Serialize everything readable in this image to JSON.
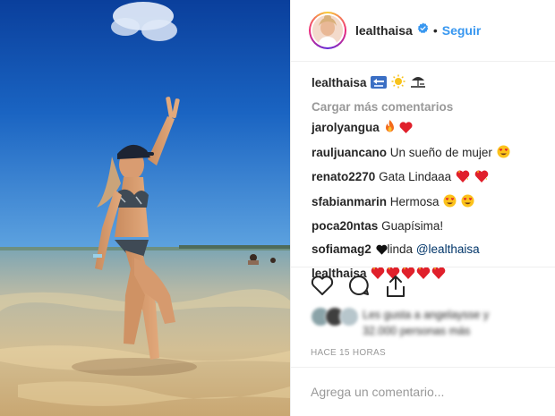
{
  "post": {
    "username": "lealthaisa",
    "separator": "•",
    "follow_label": "Seguir",
    "verified_icon": "verified-badge-icon",
    "accent_color": "#3897f0",
    "caption": {
      "username": "lealthaisa",
      "emojis": [
        "back-arrow-sign-icon",
        "sun-icon",
        "beach-umbrella-icon"
      ]
    },
    "load_more_label": "Cargar más comentarios",
    "comments": [
      {
        "username": "jarolyangua",
        "text": "",
        "emojis": [
          "fire-icon",
          "red-heart-icon"
        ]
      },
      {
        "username": "rauljuancano",
        "text": "Un sueño de mujer",
        "emojis": [
          "heart-eyes-icon"
        ]
      },
      {
        "username": "renato2270",
        "text": "Gata Lindaaa",
        "emojis": [
          "sparkling-heart-icon",
          "sparkling-heart-icon"
        ]
      },
      {
        "username": "sfabianmarin",
        "text": "Hermosa",
        "emojis": [
          "heart-eyes-icon",
          "heart-eyes-icon"
        ]
      },
      {
        "username": "poca20ntas",
        "text": "Guapísima!",
        "emojis": []
      },
      {
        "username": "sofiamag2",
        "text": "linda",
        "mention": "@lealthaisa",
        "emojis": [
          "black-heart-icon"
        ]
      },
      {
        "username": "lealthaisa",
        "text": "",
        "emojis": [
          "sparkling-heart-icon",
          "sparkling-heart-icon",
          "sparkling-heart-icon",
          "sparkling-heart-icon",
          "sparkling-heart-icon"
        ]
      }
    ],
    "actions": [
      "heart-icon",
      "comment-icon",
      "share-icon"
    ],
    "likes_line1": "Les gusta a angelaysse y",
    "likes_line2": "32.000 personas más",
    "timestamp": "HACE 15 HORAS",
    "add_comment_placeholder": "Agrega un comentario..."
  }
}
